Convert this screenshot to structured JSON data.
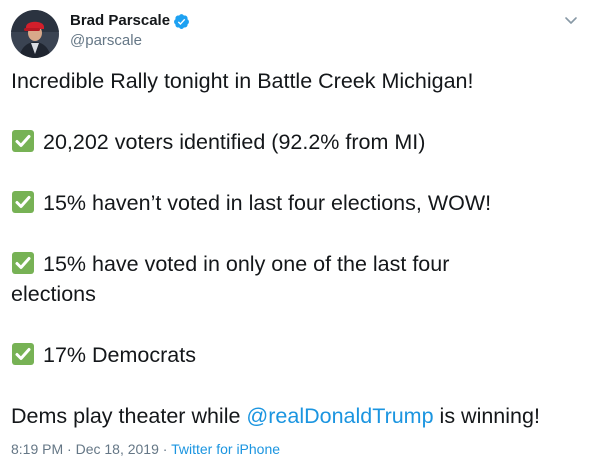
{
  "author": {
    "display_name": "Brad Parscale",
    "handle": "@parscale",
    "verified": true
  },
  "tweet": {
    "intro": "Incredible Rally tonight in Battle Creek Michigan!",
    "checklist": [
      "20,202 voters identified (92.2% from MI)",
      "15% haven’t voted in last four elections, WOW!",
      "15% have voted in only one of the last four elections",
      "17% Democrats"
    ],
    "closing_before": "Dems play theater while ",
    "closing_mention": "@realDonaldTrump",
    "closing_after": " is winning!"
  },
  "meta": {
    "time": "8:19 PM",
    "separator1": " · ",
    "date": "Dec 18, 2019",
    "separator2": " · ",
    "source": "Twitter for iPhone"
  },
  "icons": {
    "verified": "verified-badge-icon",
    "check": "white-heavy-check-mark-emoji",
    "caret": "chevron-down-icon"
  },
  "colors": {
    "text": "#14171a",
    "muted": "#657786",
    "link": "#1b95e0",
    "check_green": "#77b255",
    "verified_blue": "#1da1f2"
  }
}
